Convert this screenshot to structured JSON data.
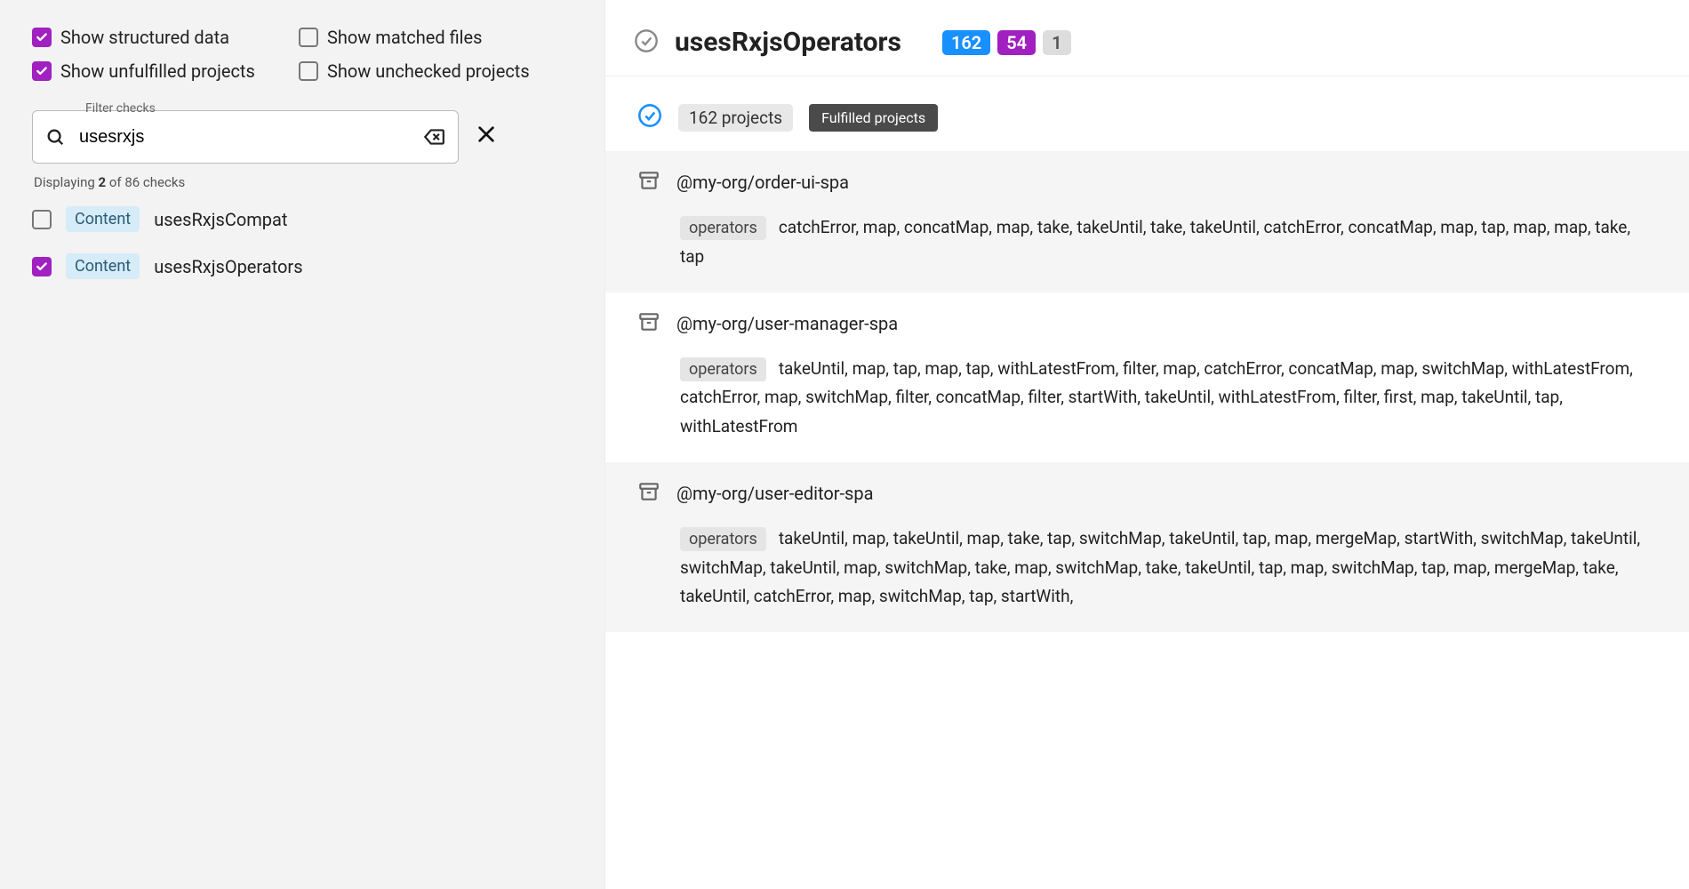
{
  "toggles": {
    "structured": {
      "label": "Show structured data",
      "checked": true
    },
    "matched": {
      "label": "Show matched files",
      "checked": false
    },
    "unfulfilled": {
      "label": "Show unfulfilled projects",
      "checked": true
    },
    "unchecked": {
      "label": "Show unchecked projects",
      "checked": false
    }
  },
  "filter": {
    "label": "Filter checks",
    "value": "usesrxjs",
    "displaying_prefix": "Displaying ",
    "displaying_count": "2",
    "displaying_suffix": " of 86 checks"
  },
  "checks": [
    {
      "tag": "Content",
      "name": "usesRxjsCompat",
      "checked": false
    },
    {
      "tag": "Content",
      "name": "usesRxjsOperators",
      "checked": true
    }
  ],
  "detail": {
    "title": "usesRxjsOperators",
    "badges": {
      "blue": "162",
      "purple": "54",
      "gray": "1"
    },
    "section": {
      "count_label": "162 projects",
      "tooltip": "Fulfilled projects"
    },
    "operators_tag": "operators",
    "projects": [
      {
        "name": "@my-org/order-ui-spa",
        "alt": true,
        "ops": "catchError, map, concatMap, map, take, takeUntil, take, takeUntil, catchError, concatMap, map, tap, map, map, take, tap"
      },
      {
        "name": "@my-org/user-manager-spa",
        "alt": false,
        "ops": "takeUntil, map, tap, map, tap, withLatestFrom, filter, map, catchError, concatMap, map, switchMap, withLatestFrom, catchError, map, switchMap, filter, concatMap, filter, startWith, takeUntil, withLatestFrom, filter, first, map, takeUntil, tap, withLatestFrom"
      },
      {
        "name": "@my-org/user-editor-spa",
        "alt": true,
        "ops": "takeUntil, map, takeUntil, map, take, tap, switchMap, takeUntil, tap, map, mergeMap, startWith, switchMap, takeUntil, switchMap, takeUntil, map, switchMap, take, map, switchMap, take, takeUntil, tap, map, switchMap, tap, map, mergeMap, take, takeUntil, catchError, map, switchMap, tap, startWith,"
      }
    ]
  }
}
